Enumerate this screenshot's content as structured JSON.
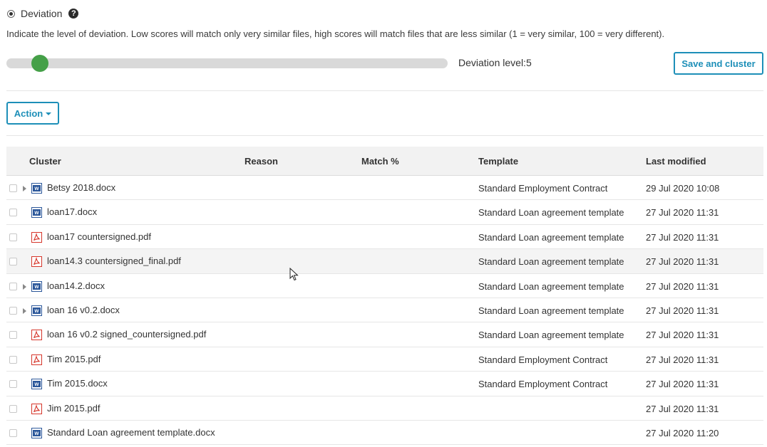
{
  "deviation": {
    "label": "Deviation",
    "help_icon": "?",
    "description": "Indicate the level of deviation. Low scores will match only very similar files, high scores will match files that are less similar (1 = very similar, 100 = very different).",
    "level_text": "Deviation level:5",
    "level_value": 5,
    "level_min": 1,
    "level_max": 100,
    "slider_color": "#45a048"
  },
  "save_button": "Save and cluster",
  "action_button": "Action",
  "accent_color": "#1d8fb8",
  "table": {
    "columns": [
      "Cluster",
      "Reason",
      "Match %",
      "Template",
      "Last modified"
    ],
    "rows": [
      {
        "name": "Betsy 2018.docx",
        "icon": "word-icon",
        "expandable": true,
        "reason": "",
        "match": "",
        "template": "Standard Employment Contract",
        "modified": "29 Jul 2020 10:08"
      },
      {
        "name": "loan17.docx",
        "icon": "word-icon",
        "expandable": false,
        "reason": "",
        "match": "",
        "template": "Standard Loan agreement template",
        "modified": "27 Jul 2020 11:31"
      },
      {
        "name": "loan17 countersigned.pdf",
        "icon": "pdf-icon",
        "expandable": false,
        "reason": "",
        "match": "",
        "template": "Standard Loan agreement template",
        "modified": "27 Jul 2020 11:31"
      },
      {
        "name": "loan14.3 countersigned_final.pdf",
        "icon": "pdf-icon",
        "expandable": false,
        "reason": "",
        "match": "",
        "template": "Standard Loan agreement template",
        "modified": "27 Jul 2020 11:31"
      },
      {
        "name": "loan14.2.docx",
        "icon": "word-icon",
        "expandable": true,
        "reason": "",
        "match": "",
        "template": "Standard Loan agreement template",
        "modified": "27 Jul 2020 11:31"
      },
      {
        "name": "loan 16 v0.2.docx",
        "icon": "word-icon",
        "expandable": true,
        "reason": "",
        "match": "",
        "template": "Standard Loan agreement template",
        "modified": "27 Jul 2020 11:31"
      },
      {
        "name": "loan 16 v0.2 signed_countersigned.pdf",
        "icon": "pdf-icon",
        "expandable": false,
        "reason": "",
        "match": "",
        "template": "Standard Loan agreement template",
        "modified": "27 Jul 2020 11:31"
      },
      {
        "name": "Tim 2015.pdf",
        "icon": "pdf-icon",
        "expandable": false,
        "reason": "",
        "match": "",
        "template": "Standard Employment Contract",
        "modified": "27 Jul 2020 11:31"
      },
      {
        "name": "Tim 2015.docx",
        "icon": "word-icon",
        "expandable": false,
        "reason": "",
        "match": "",
        "template": "Standard Employment Contract",
        "modified": "27 Jul 2020 11:31"
      },
      {
        "name": "Jim 2015.pdf",
        "icon": "pdf-icon",
        "expandable": false,
        "reason": "",
        "match": "",
        "template": "",
        "modified": "27 Jul 2020 11:31"
      },
      {
        "name": "Standard Loan agreement template.docx",
        "icon": "word-icon",
        "expandable": false,
        "reason": "",
        "match": "",
        "template": "",
        "modified": "27 Jul 2020 11:20"
      }
    ]
  }
}
